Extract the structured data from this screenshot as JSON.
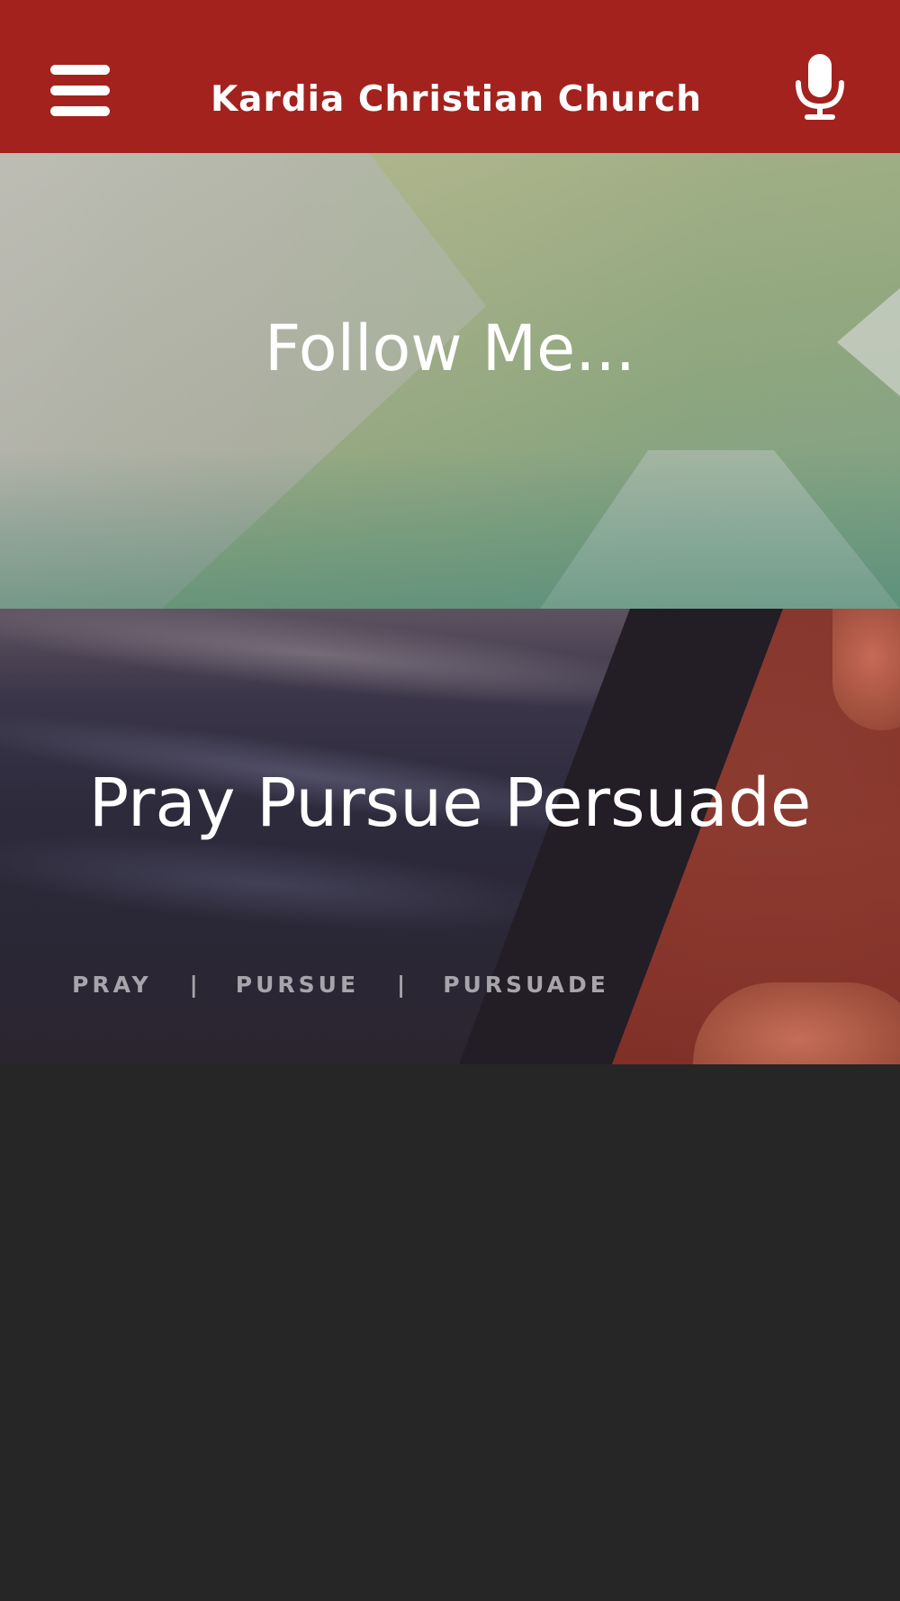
{
  "header": {
    "title": "Kardia Christian Church",
    "menu_icon": "hamburger-menu-icon",
    "mic_icon": "microphone-icon",
    "background_color": "#a3221e"
  },
  "cards": [
    {
      "title": "Follow Me..."
    },
    {
      "title": "Pray Pursue Persuade",
      "subtitle": {
        "item1": "PRAY",
        "separator1": "|",
        "item2": "PURSUE",
        "separator2": "|",
        "item3": "PURSUADE"
      }
    }
  ],
  "colors": {
    "page_background": "#262626",
    "text": "#ffffff"
  }
}
